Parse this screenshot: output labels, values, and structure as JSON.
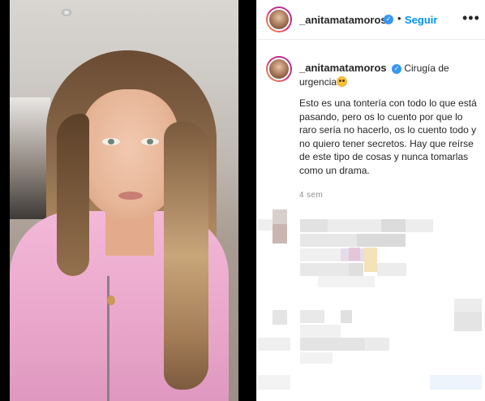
{
  "post": {
    "author": {
      "username": "_anitamatamoros",
      "verified": true
    },
    "header": {
      "separator": "•",
      "follow_label": "Seguir",
      "more_icon": "more-horizontal-icon"
    },
    "caption": {
      "title_text": "Cirugía de urgencia",
      "emoji": "hugging-face-emoji",
      "body": "Esto es una tontería con todo lo que está pasando, pero os lo cuento por que lo raro sería no hacerlo, os lo cuento todo y no quiero tener secretos. Hay que reírse de este tipo de cosas y nunca tomarlas como un drama."
    },
    "time_ago": "4 sem"
  },
  "colors": {
    "link_blue": "#0095f6",
    "verified_blue": "#3897f0",
    "text": "#262626",
    "muted": "#8e8e8e"
  }
}
